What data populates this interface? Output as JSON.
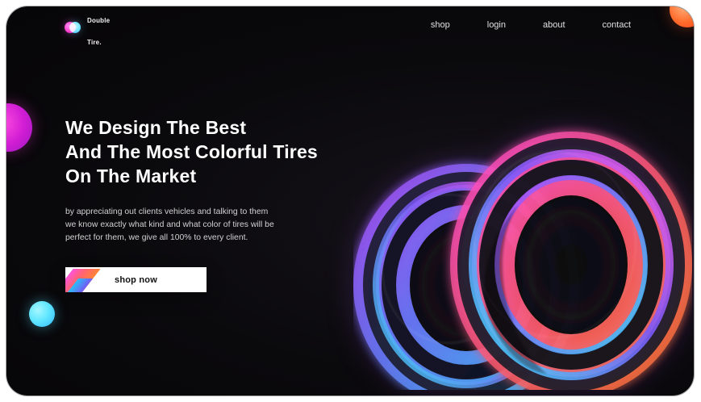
{
  "brand": {
    "name_line1": "Double",
    "name_line2": "Tire."
  },
  "nav": {
    "items": [
      {
        "label": "shop"
      },
      {
        "label": "login"
      },
      {
        "label": "about"
      },
      {
        "label": "contact"
      }
    ]
  },
  "hero": {
    "headline_lines": [
      "We Design The Best",
      "And The Most Colorful Tires",
      "On The Market"
    ],
    "body_lines": [
      "by appreciating out clients vehicles and talking to them",
      "we know exactly what kind and what color of tires will be",
      "perfect for them, we give all 100% to every client."
    ],
    "cta_label": "shop now"
  },
  "colors": {
    "background": "#0a090c",
    "accent_pink": "#ff2ec7",
    "accent_cyan": "#5fe1ff",
    "accent_orange": "#ff6a2a",
    "cta_background": "#ffffff",
    "cta_text": "#111111"
  },
  "icons": {
    "logo": "two-overlapping-circles-logo",
    "decorative_left_1": "pink-circle",
    "decorative_left_2": "cyan-circle",
    "decorative_top_right": "orange-circle"
  }
}
